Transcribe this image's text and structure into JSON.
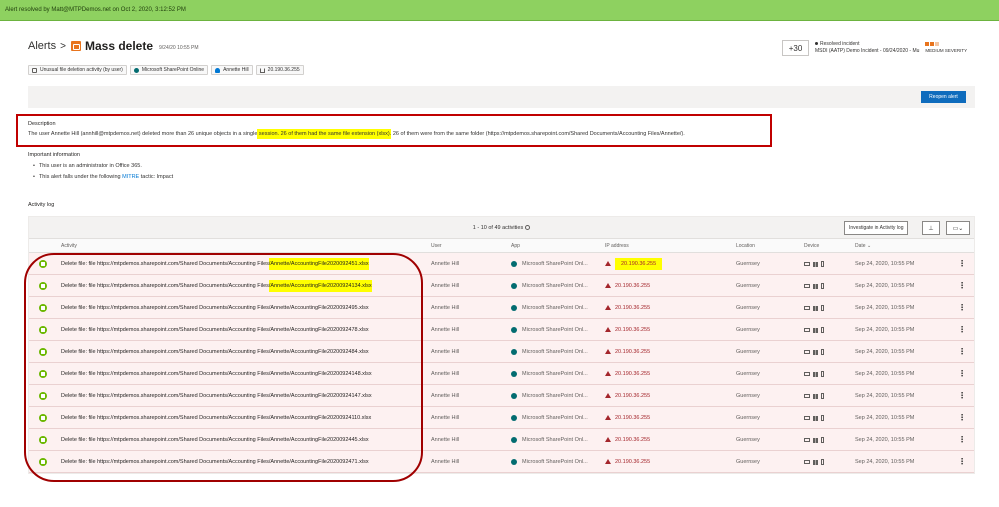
{
  "banner": "Alert resolved by Matt@MTPDemos.net on Oct 2, 2020, 3:12:52 PM",
  "header": {
    "breadcrumb": "Alerts",
    "separator": ">",
    "title": "Mass delete",
    "date": "9/24/20 10:55 PM"
  },
  "tags": [
    {
      "icon": "file-icon",
      "label": "Unusual file deletion activity (by user)"
    },
    {
      "icon": "sharepoint-icon",
      "label": "Microsoft SharePoint Online"
    },
    {
      "icon": "user-icon",
      "label": "Annette Hill"
    },
    {
      "icon": "ip-icon",
      "label": "20.190.36.255"
    }
  ],
  "incident": {
    "count": "+30",
    "status": "Resolved incident",
    "name": "MSDI (AATP) Demo Incident - 09/24/2020 - Mu",
    "severity": "MEDIUM SEVERITY"
  },
  "toolbar": {
    "reopen": "Reopen alert"
  },
  "description": {
    "heading": "Description",
    "part1": "The user Annette Hill (annhill@mtpdemos.net) deleted more than 26 unique objects in a single",
    "highlight1": " session. 26 of them had the same file extension (xlsx).",
    "part2": " 26 of them were from the same folder (https://mtpdemos.sharepoint.com/Shared Documents/Accounting Files/Annette/)."
  },
  "important": {
    "heading": "Important information",
    "item1": "This user is an administrator in Office 365.",
    "item2_prefix": "This alert falls under the following ",
    "item2_link": "MITRE",
    "item2_suffix": " tactic: Impact"
  },
  "activity_log": {
    "heading": "Activity log",
    "pager": "1 - 10 of 49 activities",
    "investigate": "Investigate in Activity log",
    "columns": {
      "activity": "Activity",
      "user": "User",
      "app": "App",
      "ip": "IP address",
      "location": "Location",
      "device": "Device",
      "date": "Date ⌄"
    },
    "rows": [
      {
        "prefix": "Delete file: file https://mtpdemos.sharepoint.com/Shared Documents/Accounting Files",
        "suffix": "/Annette/AccountingFile2020092451.xlsx",
        "user": "Annette Hill",
        "app": "Microsoft SharePoint Onl...",
        "ip": "20.190.36.255",
        "location": "Guernsey",
        "date": "Sep 24, 2020, 10:55 PM"
      },
      {
        "prefix": "Delete file: file https://mtpdemos.sharepoint.com/Shared Documents/Accounting Files",
        "suffix": "/Annette/AccountingFile20200924134.xlsx",
        "user": "Annette Hill",
        "app": "Microsoft SharePoint Onl...",
        "ip": "20.190.36.255",
        "location": "Guernsey",
        "date": "Sep 24, 2020, 10:55 PM"
      },
      {
        "prefix": "Delete file: file https://mtpdemos.sharepoint.com/Shared Documents/Accounting Files",
        "suffix": "/Annette/AccountingFile2020092495.xlsx",
        "user": "Annette Hill",
        "app": "Microsoft SharePoint Onl...",
        "ip": "20.190.36.255",
        "location": "Guernsey",
        "date": "Sep 24, 2020, 10:55 PM"
      },
      {
        "prefix": "Delete file: file https://mtpdemos.sharepoint.com/Shared Documents/Accounting Files",
        "suffix": "/Annette/AccountingFile2020092478.xlsx",
        "user": "Annette Hill",
        "app": "Microsoft SharePoint Onl...",
        "ip": "20.190.36.255",
        "location": "Guernsey",
        "date": "Sep 24, 2020, 10:55 PM"
      },
      {
        "prefix": "Delete file: file https://mtpdemos.sharepoint.com/Shared Documents/Accounting Files",
        "suffix": "/Annette/AccountingFile2020092484.xlsx",
        "user": "Annette Hill",
        "app": "Microsoft SharePoint Onl...",
        "ip": "20.190.36.255",
        "location": "Guernsey",
        "date": "Sep 24, 2020, 10:55 PM"
      },
      {
        "prefix": "Delete file: file https://mtpdemos.sharepoint.com/Shared Documents/Accounting Files",
        "suffix": "/Annette/AccountingFile20200924148.xlsx",
        "user": "Annette Hill",
        "app": "Microsoft SharePoint Onl...",
        "ip": "20.190.36.255",
        "location": "Guernsey",
        "date": "Sep 24, 2020, 10:55 PM"
      },
      {
        "prefix": "Delete file: file https://mtpdemos.sharepoint.com/Shared Documents/Accounting Files",
        "suffix": "/Annette/AccountingFile20200924147.xlsx",
        "user": "Annette Hill",
        "app": "Microsoft SharePoint Onl...",
        "ip": "20.190.36.255",
        "location": "Guernsey",
        "date": "Sep 24, 2020, 10:55 PM"
      },
      {
        "prefix": "Delete file: file https://mtpdemos.sharepoint.com/Shared Documents/Accounting Files",
        "suffix": "/Annette/AccountingFile20200924110.xlsx",
        "user": "Annette Hill",
        "app": "Microsoft SharePoint Onl...",
        "ip": "20.190.36.255",
        "location": "Guernsey",
        "date": "Sep 24, 2020, 10:55 PM"
      },
      {
        "prefix": "Delete file: file https://mtpdemos.sharepoint.com/Shared Documents/Accounting Files",
        "suffix": "/Annette/AccountingFile2020092445.xlsx",
        "user": "Annette Hill",
        "app": "Microsoft SharePoint Onl...",
        "ip": "20.190.36.255",
        "location": "Guernsey",
        "date": "Sep 24, 2020, 10:55 PM"
      },
      {
        "prefix": "Delete file: file https://mtpdemos.sharepoint.com/Shared Documents/Accounting Files",
        "suffix": "/Annette/AccountingFile2020092471.xlsx",
        "user": "Annette Hill",
        "app": "Microsoft SharePoint Onl...",
        "ip": "20.190.36.255",
        "location": "Guernsey",
        "date": "Sep 24, 2020, 10:55 PM"
      }
    ]
  },
  "colors": {
    "banner": "#8ed160",
    "accent": "#0f6cbd",
    "alert_orange": "#e8741d",
    "danger": "#a4262c",
    "highlight": "#ffff00",
    "annotation": "#c00000"
  }
}
